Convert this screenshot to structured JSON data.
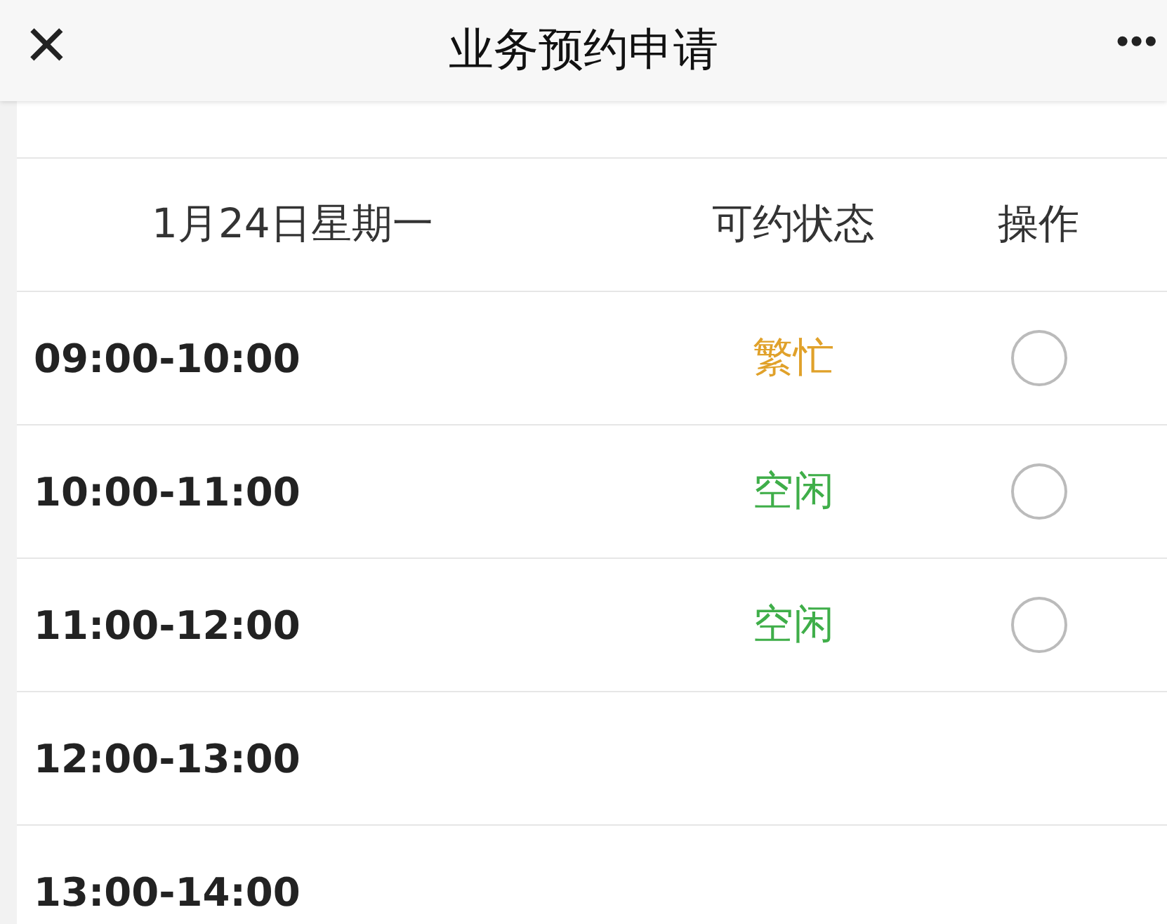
{
  "header": {
    "close": "×",
    "title": "业务预约申请",
    "more": "•••"
  },
  "table": {
    "columns": [
      "1月24日星期一",
      "可约状态",
      "操作"
    ],
    "rows": [
      {
        "time": "09:00-10:00",
        "kind": "bookable",
        "status": "繁忙",
        "color": "#e0a12a",
        "selected": false
      },
      {
        "time": "10:00-11:00",
        "kind": "bookable",
        "status": "空闲",
        "color": "#3fae49",
        "selected": false
      },
      {
        "time": "11:00-12:00",
        "kind": "bookable",
        "status": "空闲",
        "color": "#3fae49",
        "selected": false
      },
      {
        "time": "12:00-13:00",
        "kind": "closed"
      },
      {
        "time": "13:00-14:00",
        "kind": "closed"
      }
    ]
  }
}
